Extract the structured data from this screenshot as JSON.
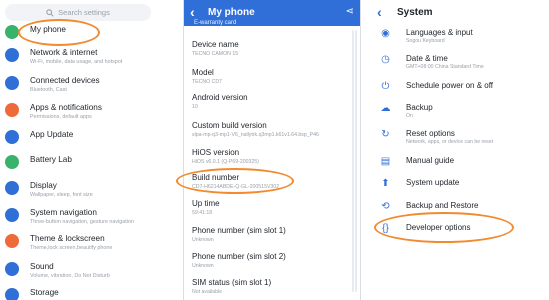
{
  "colors": {
    "accent": "#2f6fd7",
    "highlight": "#f28a2e",
    "text": "#1e2329",
    "subtext": "#9aa0a8"
  },
  "settings": {
    "search_placeholder": "Search settings",
    "items": [
      {
        "icon": "phone-icon",
        "color": "#39b26b",
        "title": "My phone",
        "sub": ""
      },
      {
        "icon": "wifi-icon",
        "color": "#2f6fd7",
        "title": "Network & internet",
        "sub": "Wi-Fi, mobile, data usage, and hotspot"
      },
      {
        "icon": "devices-icon",
        "color": "#2f6fd7",
        "title": "Connected devices",
        "sub": "Bluetooth, Cast"
      },
      {
        "icon": "apps-icon",
        "color": "#ef6a3a",
        "title": "Apps & notifications",
        "sub": "Permissions, default apps"
      },
      {
        "icon": "update-icon",
        "color": "#2f6fd7",
        "title": "App Update",
        "sub": ""
      },
      {
        "icon": "battery-icon",
        "color": "#39b26b",
        "title": "Battery Lab",
        "sub": ""
      },
      {
        "icon": "display-icon",
        "color": "#2f6fd7",
        "title": "Display",
        "sub": "Wallpaper, sleep, font size"
      },
      {
        "icon": "navigation-icon",
        "color": "#2f6fd7",
        "title": "System navigation",
        "sub": "Three-button navigation, gesture navigation"
      },
      {
        "icon": "theme-icon",
        "color": "#ef6a3a",
        "title": "Theme & lockscreen",
        "sub": "Theme,lock screen,beautify phone"
      },
      {
        "icon": "sound-icon",
        "color": "#2f6fd7",
        "title": "Sound",
        "sub": "Volume, vibration, Do Not Disturb"
      },
      {
        "icon": "storage-icon",
        "color": "#2f6fd7",
        "title": "Storage",
        "sub": ""
      }
    ]
  },
  "my_phone": {
    "title": "My phone",
    "peek": "E-warranty card",
    "rows": [
      {
        "label": "Device name",
        "value": "TECNO CAMON 15"
      },
      {
        "label": "Model",
        "value": "TECNO CD7"
      },
      {
        "label": "Android version",
        "value": "10"
      },
      {
        "label": "Custom build version",
        "value": "slpa-mp-q3-mp1-V6_nallytrk.q3mp1.k61v1.64.bsp_P46"
      },
      {
        "label": "HiOS version",
        "value": "HiOS v6.0.1 (Q-P69-200325)"
      },
      {
        "label": "Build number",
        "value": "CD7-H6214ABDE-Q-GL-200515V302"
      },
      {
        "label": "Up time",
        "value": "59:41:18"
      },
      {
        "label": "Phone number (sim slot 1)",
        "value": "Unknown"
      },
      {
        "label": "Phone number (sim slot 2)",
        "value": "Unknown"
      },
      {
        "label": "SIM status (sim slot 1)",
        "value": "Not available"
      }
    ]
  },
  "system": {
    "title": "System",
    "items": [
      {
        "icon": "globe-icon",
        "glyph": "◉",
        "title": "Languages & input",
        "sub": "Sogou Keyboard"
      },
      {
        "icon": "clock-icon",
        "glyph": "◷",
        "title": "Date & time",
        "sub": "GMT+08:00 China Standard Time"
      },
      {
        "icon": "power-icon",
        "glyph": "⏻",
        "title": "Schedule power on & off",
        "sub": ""
      },
      {
        "icon": "backup-icon",
        "glyph": "☁",
        "title": "Backup",
        "sub": "On"
      },
      {
        "icon": "reset-icon",
        "glyph": "↻",
        "title": "Reset options",
        "sub": "Network, apps, or device can be reset"
      },
      {
        "icon": "manual-icon",
        "glyph": "▤",
        "title": "Manual guide",
        "sub": ""
      },
      {
        "icon": "system-update-icon",
        "glyph": "⬆",
        "title": "System update",
        "sub": ""
      },
      {
        "icon": "restore-icon",
        "glyph": "⟲",
        "title": "Backup and Restore",
        "sub": ""
      },
      {
        "icon": "developer-icon",
        "glyph": "{}",
        "title": "Developer options",
        "sub": ""
      }
    ]
  }
}
